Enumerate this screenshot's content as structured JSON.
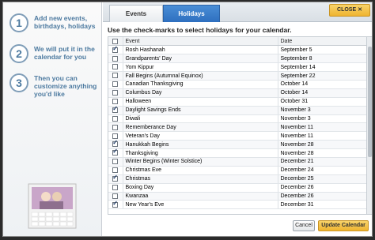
{
  "sidebar": {
    "steps": [
      {
        "num": "1",
        "text": "Add new events, birthdays, holidays"
      },
      {
        "num": "2",
        "text": "We will put it in the calendar for you"
      },
      {
        "num": "3",
        "text": "Then you can customize anything you'd like"
      }
    ]
  },
  "tabs": {
    "events": "Events",
    "holidays": "Holidays"
  },
  "close_label": "CLOSE ✕",
  "instructions": "Use the check-marks to select holidays for your calendar.",
  "table": {
    "headers": {
      "event": "Event",
      "date": "Date"
    },
    "rows": [
      {
        "checked": true,
        "event": "Rosh Hashanah",
        "date": "September 5"
      },
      {
        "checked": false,
        "event": "Grandparents' Day",
        "date": "September 8"
      },
      {
        "checked": false,
        "event": "Yom Kippur",
        "date": "September 14"
      },
      {
        "checked": false,
        "event": "Fall Begins (Autumnal Equinox)",
        "date": "September 22"
      },
      {
        "checked": false,
        "event": "Canadian Thanksgiving",
        "date": "October 14"
      },
      {
        "checked": false,
        "event": "Columbus Day",
        "date": "October 14"
      },
      {
        "checked": false,
        "event": "Halloween",
        "date": "October 31"
      },
      {
        "checked": true,
        "event": "Daylight Savings Ends",
        "date": "November 3"
      },
      {
        "checked": false,
        "event": "Diwali",
        "date": "November 3"
      },
      {
        "checked": false,
        "event": "Rememberance Day",
        "date": "November 11"
      },
      {
        "checked": false,
        "event": "Veteran's Day",
        "date": "November 11"
      },
      {
        "checked": true,
        "event": "Hanukkah Begins",
        "date": "November 28"
      },
      {
        "checked": true,
        "event": "Thanksgiving",
        "date": "November 28"
      },
      {
        "checked": false,
        "event": "Winter Begins (Winter Solstice)",
        "date": "December 21"
      },
      {
        "checked": false,
        "event": "Christmas Eve",
        "date": "December 24"
      },
      {
        "checked": true,
        "event": "Christmas",
        "date": "December 25"
      },
      {
        "checked": false,
        "event": "Boxing Day",
        "date": "December 26"
      },
      {
        "checked": false,
        "event": "Kwanzaa",
        "date": "December 26"
      },
      {
        "checked": true,
        "event": "New Year's Eve",
        "date": "December 31"
      }
    ]
  },
  "footer": {
    "cancel": "Cancel",
    "update": "Update Calendar"
  }
}
